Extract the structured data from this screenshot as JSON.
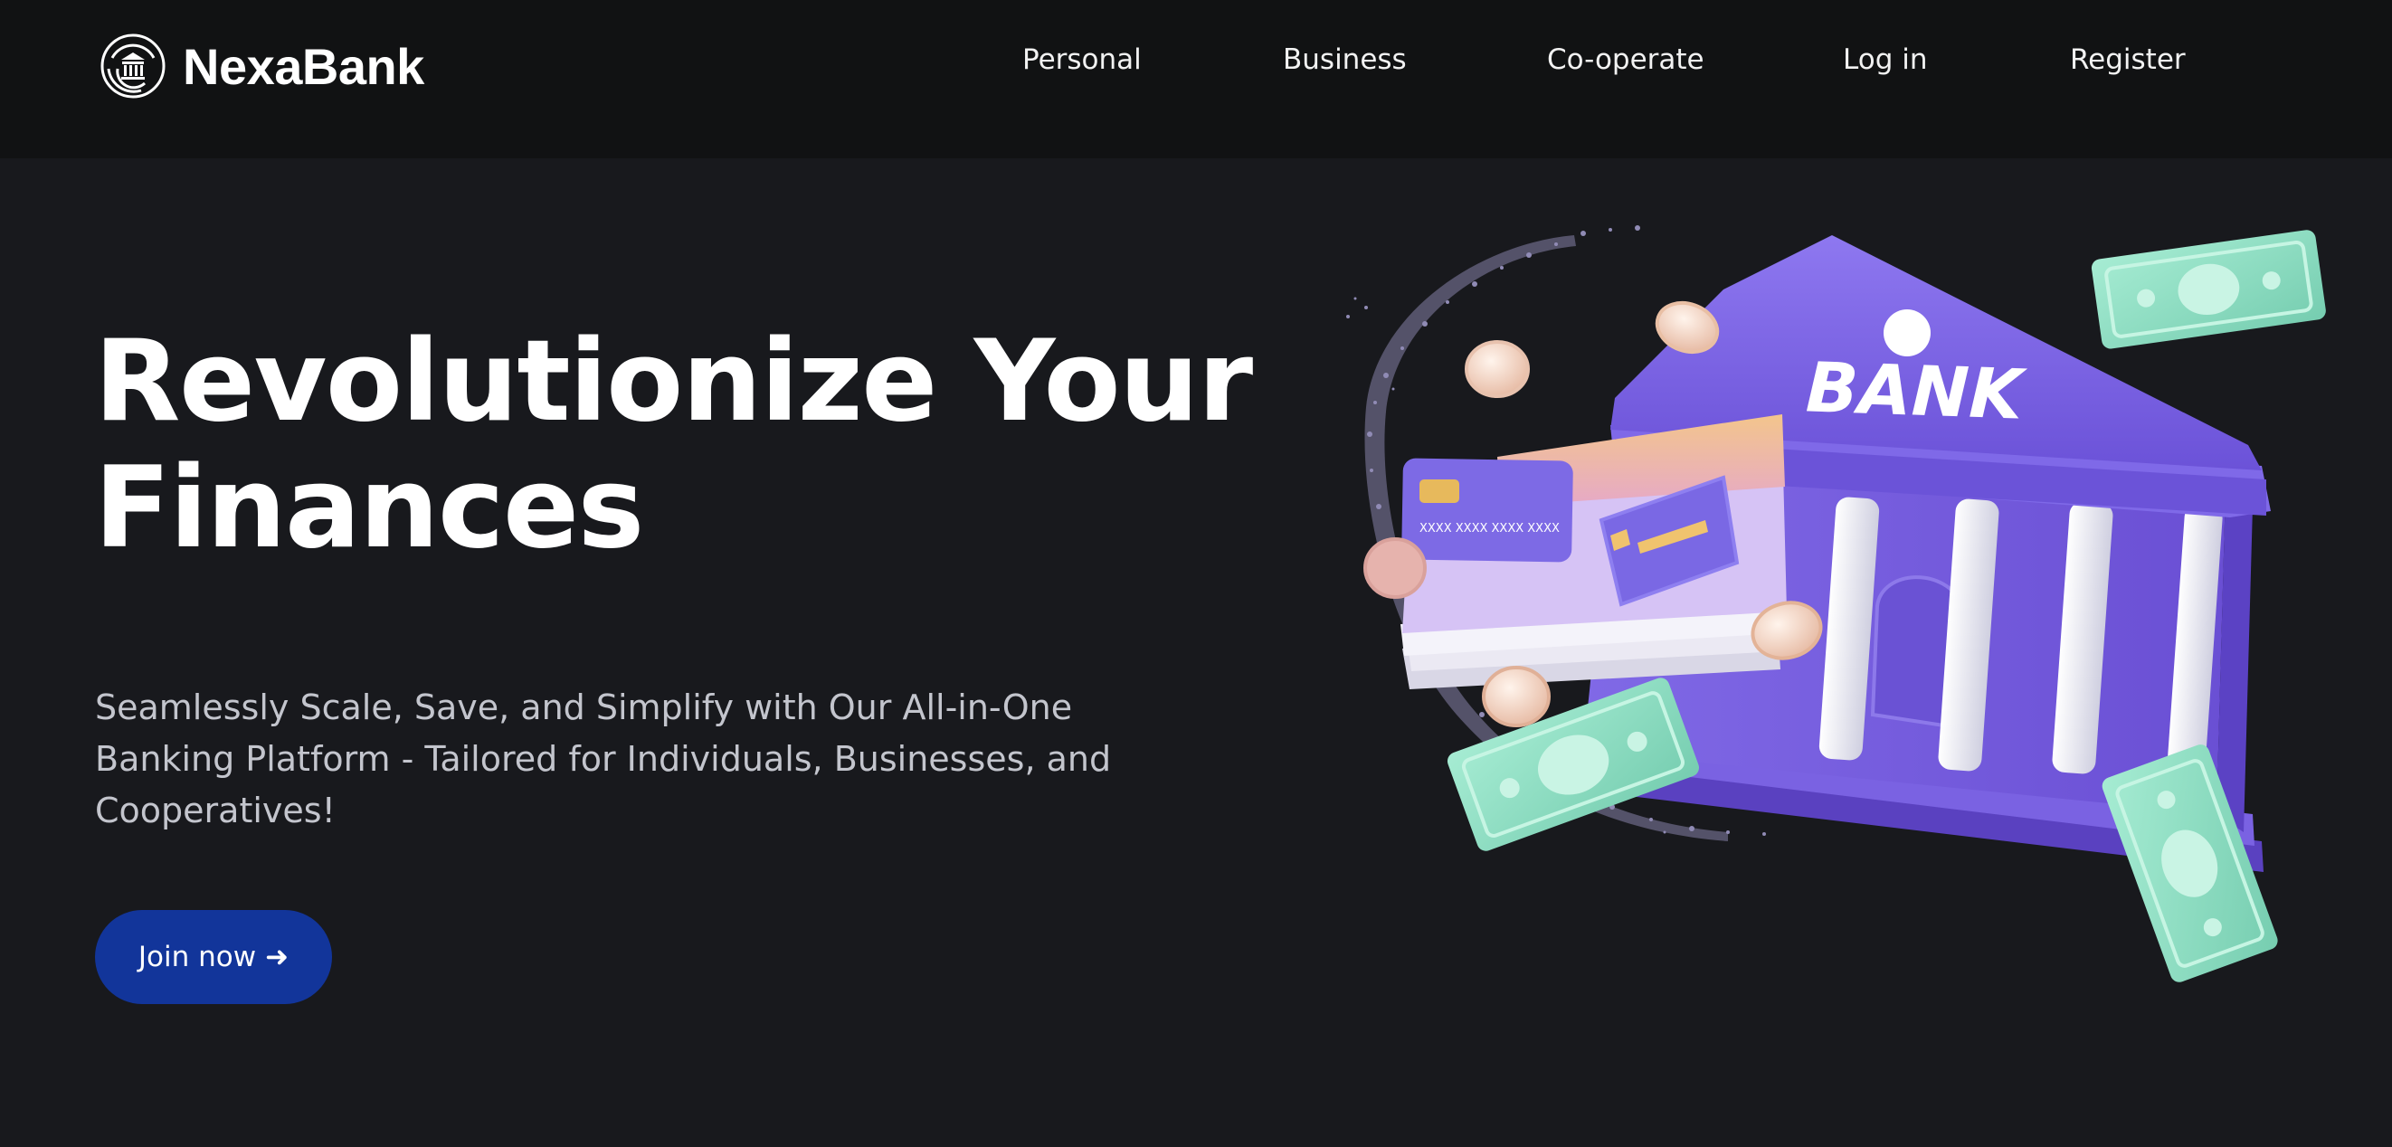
{
  "brand": {
    "name": "NexaBank",
    "logo_icon": "bank-seal-icon"
  },
  "nav": {
    "links": [
      {
        "label": "Personal"
      },
      {
        "label": "Business"
      },
      {
        "label": "Co-operate"
      },
      {
        "label": "Log in"
      },
      {
        "label": "Register"
      }
    ]
  },
  "hero": {
    "title_line1": "Revolutionize Your",
    "title_line2": "Finances",
    "subtitle": "Seamlessly Scale, Save, and Simplify with Our All-in-One Banking Platform - Tailored for Individuals, Businesses, and Cooperatives!",
    "cta_label": "Join now",
    "cta_icon": "arrow-right-icon"
  },
  "illustration": {
    "bank_sign": "BANK",
    "card_number": "XXXX XXXX XXXX XXXX"
  },
  "colors": {
    "background": "#18191d",
    "navbar": "#111213",
    "cta": "#12359a",
    "bank_purple": "#7b62e0",
    "cash_green": "#8fdcc0"
  }
}
